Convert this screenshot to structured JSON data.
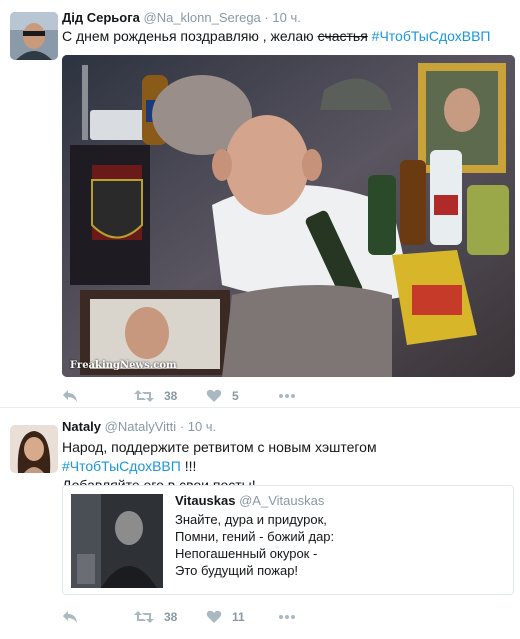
{
  "tweets": [
    {
      "fullname": "Дід Серьога",
      "handle": "@Na_klonn_Serega",
      "dot": "·",
      "time": "10 ч.",
      "text_before": "С днем рожденья поздравляю , желаю ",
      "text_strike": "счастья",
      "text_space": " ",
      "hashtag": "#ЧтобТыСдохВВП",
      "media_watermark": "FreakingNews.com",
      "retweets": "38",
      "likes": "5"
    },
    {
      "fullname": "Nataly",
      "handle": "@NatalyVitti",
      "dot": "·",
      "time": "10 ч.",
      "text_before": "Народ, поддержите ретвитом с новым хэштегом ",
      "hashtag": "#ЧтобТыСдохВВП",
      "text_after": " !!!",
      "text_line2": "Добавляйте его в свои посты!",
      "quote": {
        "name": "Vitauskas",
        "handle": "@A_Vitauskas",
        "lines": [
          "Знайте, дура и придурок,",
          "Помни, гений - божий дар:",
          "Непогашенный окурок -",
          "Это будущий пожар!"
        ]
      },
      "retweets": "38",
      "likes": "11"
    }
  ],
  "icons": {
    "reply": "reply-icon",
    "retweet": "retweet-icon",
    "like": "heart-icon",
    "more": "more-icon"
  },
  "colors": {
    "hashtag": "#1b95e0",
    "muted": "#8899a6",
    "icon": "#aab8c2"
  }
}
